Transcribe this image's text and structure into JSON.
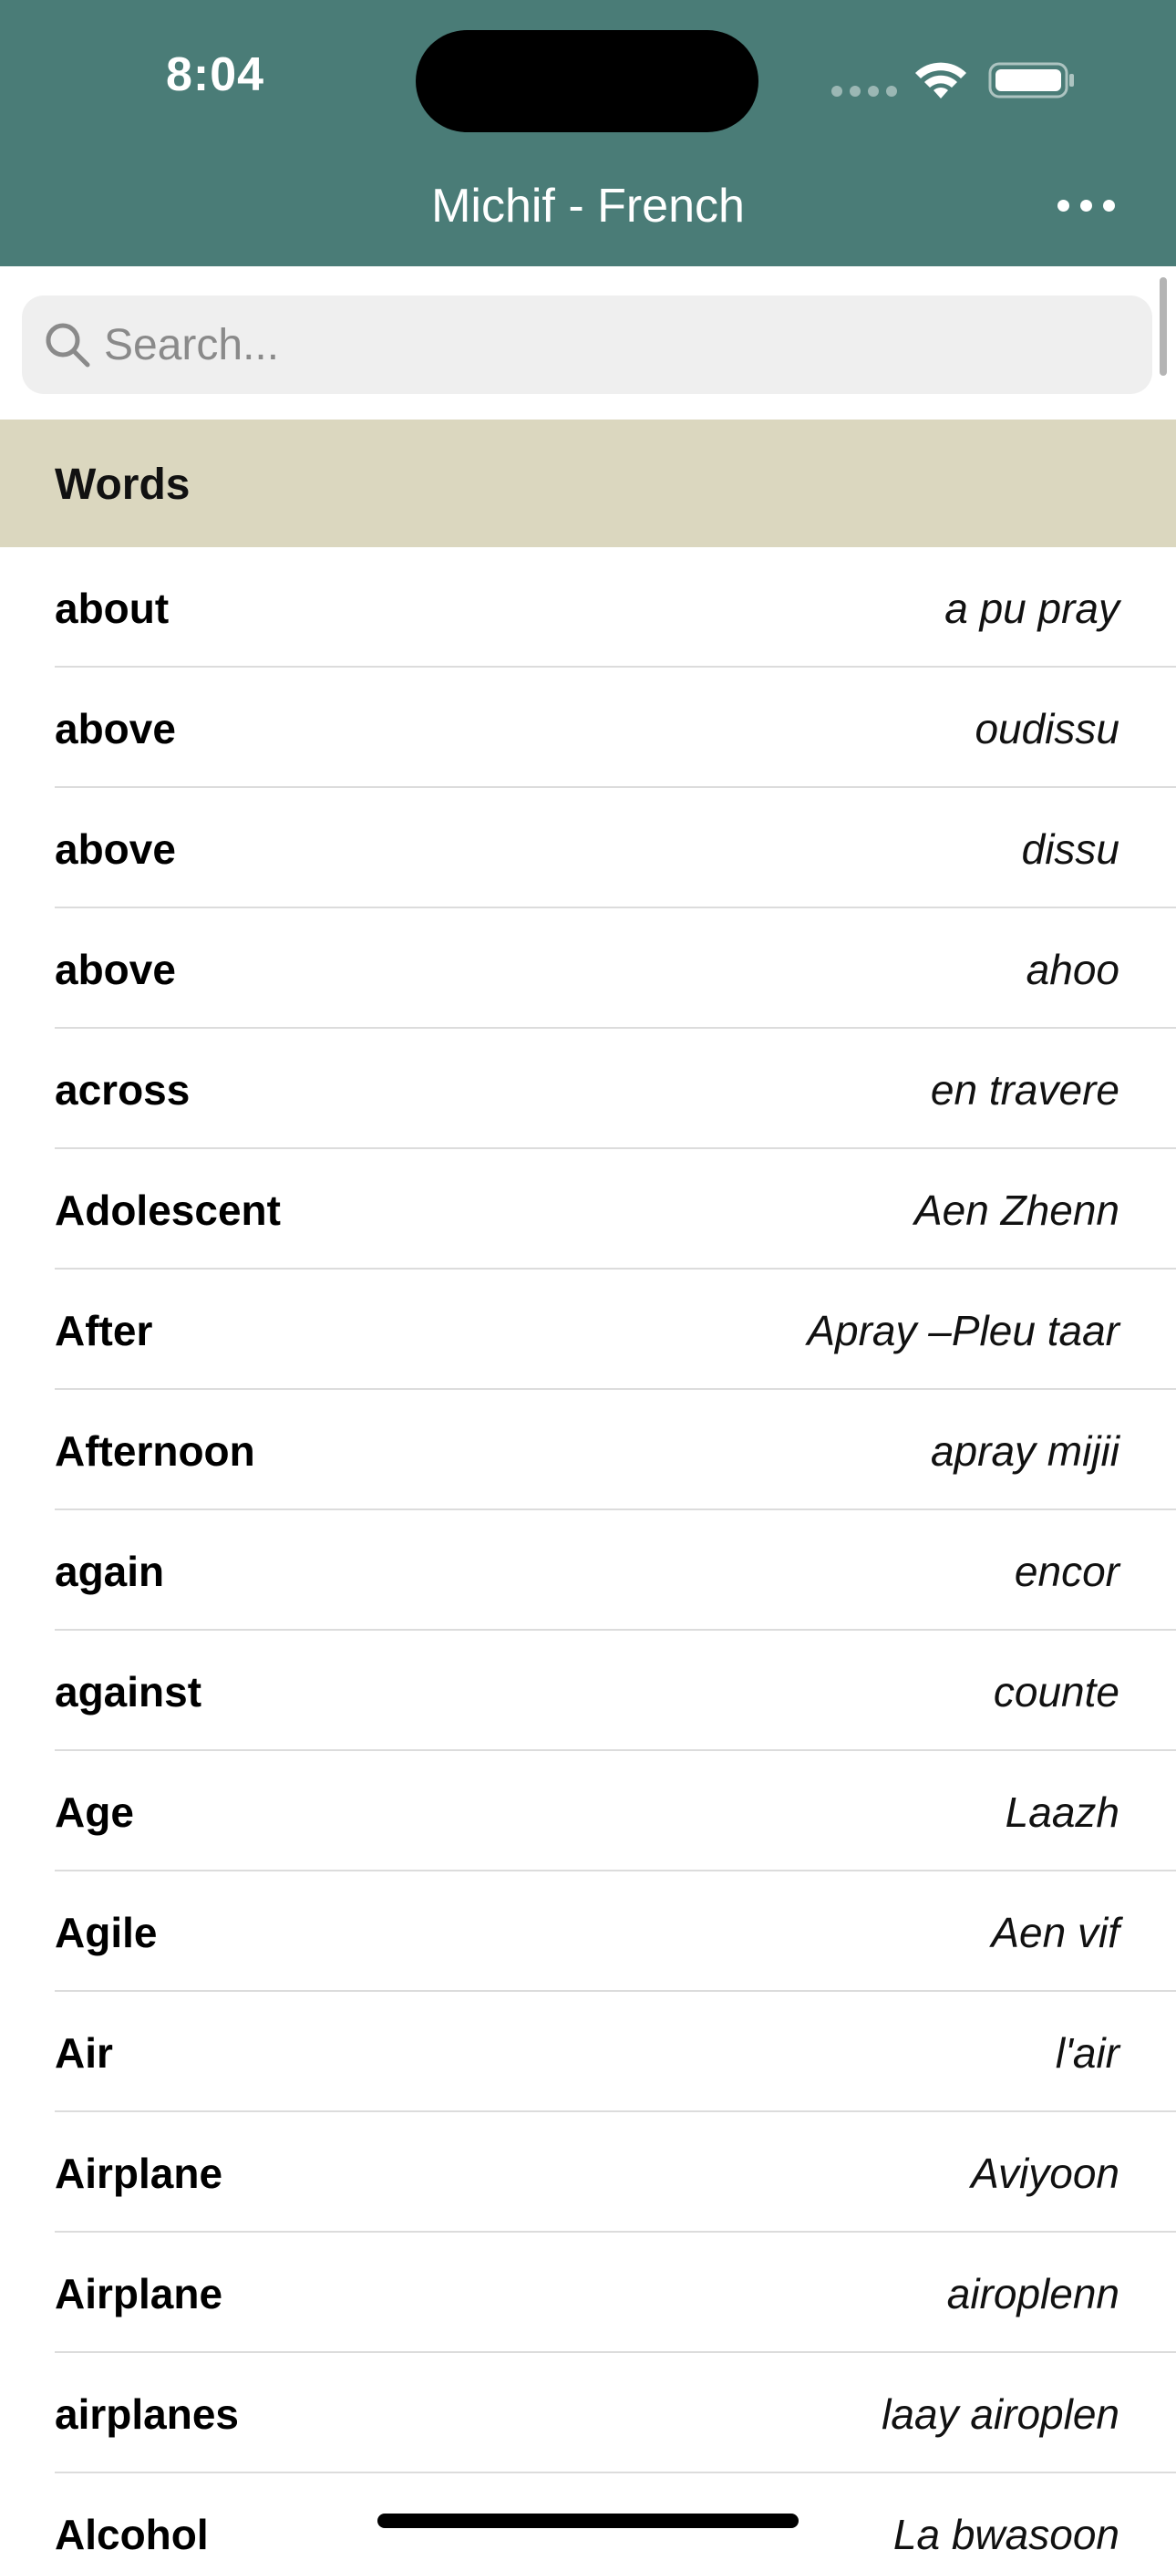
{
  "status_bar": {
    "time": "8:04"
  },
  "nav": {
    "title": "Michif - French",
    "more_icon": "ellipsis-icon"
  },
  "search": {
    "placeholder": "Search...",
    "value": "",
    "icon": "search-icon"
  },
  "section": {
    "title": "Words"
  },
  "words": [
    {
      "english": "about",
      "translation": "a pu pray"
    },
    {
      "english": "above",
      "translation": "oudissu"
    },
    {
      "english": "above",
      "translation": "dissu"
    },
    {
      "english": "above",
      "translation": "ahoo"
    },
    {
      "english": "across",
      "translation": "en travere"
    },
    {
      "english": "Adolescent",
      "translation": "Aen Zhenn"
    },
    {
      "english": "After",
      "translation": "Apray –Pleu taar"
    },
    {
      "english": "Afternoon",
      "translation": "apray mijii"
    },
    {
      "english": "again",
      "translation": "encor"
    },
    {
      "english": "against",
      "translation": "counte"
    },
    {
      "english": "Age",
      "translation": "Laazh"
    },
    {
      "english": "Agile",
      "translation": "Aen vif"
    },
    {
      "english": "Air",
      "translation": "l'air"
    },
    {
      "english": "Airplane",
      "translation": "Aviyoon"
    },
    {
      "english": "Airplane",
      "translation": "airoplenn"
    },
    {
      "english": "airplanes",
      "translation": "laay airoplen"
    },
    {
      "english": "Alcohol",
      "translation": "La bwasoon"
    }
  ],
  "colors": {
    "header": "#4a7c77",
    "section_header": "#dbd7bf",
    "search_bg": "#efefef"
  }
}
